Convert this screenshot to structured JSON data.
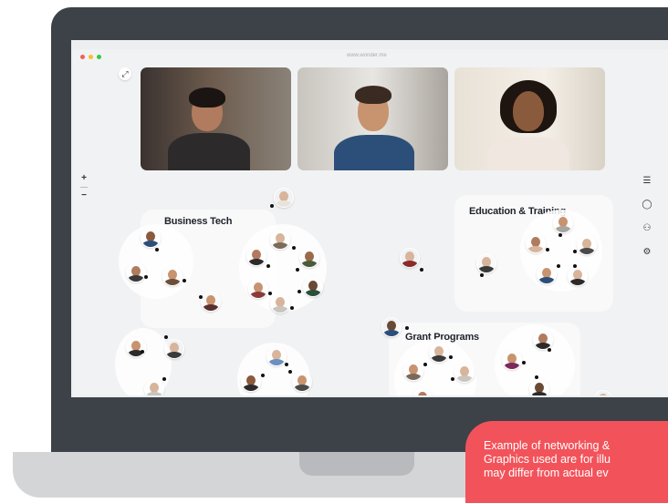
{
  "browser": {
    "url": "www.wonder.me",
    "dot_colors": [
      "#f25f58",
      "#fbbe2e",
      "#38c93f"
    ]
  },
  "controls": {
    "expand_icon": "expand-arrows-icon",
    "zoom_in": "+",
    "zoom_out": "−"
  },
  "toolbar": {
    "icons": [
      "list-icon",
      "chat-icon",
      "people-icon",
      "settings-icon"
    ]
  },
  "rooms": {
    "business_tech": "Business Tech",
    "education_training": "Education & Training",
    "grant_programs": "Grant Programs"
  },
  "banner": {
    "line1": "Example of networking &",
    "line2": "Graphics used are for illu",
    "line3": "may differ from actual ev",
    "color": "#f2535a"
  },
  "colors": {
    "laptop_frame": "#3d4248",
    "canvas": "#f1f2f4"
  }
}
